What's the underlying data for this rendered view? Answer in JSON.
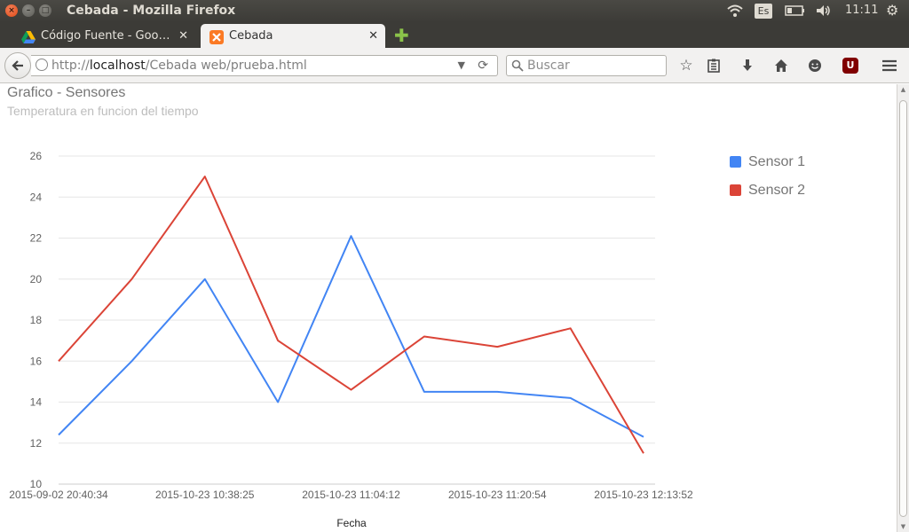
{
  "window": {
    "title": "Cebada - Mozilla Firefox",
    "keyboard_layout": "Es",
    "clock": "11:11"
  },
  "tabs": [
    {
      "label": "Código Fuente - Goo…",
      "active": false,
      "icon": "google-drive-icon"
    },
    {
      "label": "Cebada",
      "active": true,
      "icon": "xampp-icon"
    }
  ],
  "navbar": {
    "url_scheme": "http://",
    "url_host": "localhost",
    "url_path": "/Cebada web/prueba.html",
    "search_placeholder": "Buscar"
  },
  "page": {
    "title": "Grafico - Sensores",
    "subtitle": "Temperatura en funcion del tiempo"
  },
  "colors": {
    "sensor1": "#4285f4",
    "sensor2": "#db4437"
  },
  "chart_data": {
    "type": "line",
    "title": "Grafico - Sensores",
    "subtitle": "Temperatura en funcion del tiempo",
    "xlabel": "Fecha",
    "ylabel": "",
    "ylim": [
      10,
      26
    ],
    "yticks": [
      10,
      12,
      14,
      16,
      18,
      20,
      22,
      24,
      26
    ],
    "x_tick_labels": [
      "2015-09-02 20:40:34",
      "2015-10-23 10:38:25",
      "2015-10-23 11:04:12",
      "2015-10-23 11:20:54",
      "2015-10-23 12:13:52"
    ],
    "grid": true,
    "legend_position": "right",
    "series": [
      {
        "name": "Sensor 1",
        "values": [
          12.4,
          16.0,
          20.0,
          14.0,
          22.1,
          14.5,
          14.5,
          14.2,
          12.3
        ]
      },
      {
        "name": "Sensor 2",
        "values": [
          16.0,
          20.0,
          25.0,
          17.0,
          14.6,
          17.2,
          16.7,
          17.6,
          11.5
        ]
      }
    ]
  }
}
